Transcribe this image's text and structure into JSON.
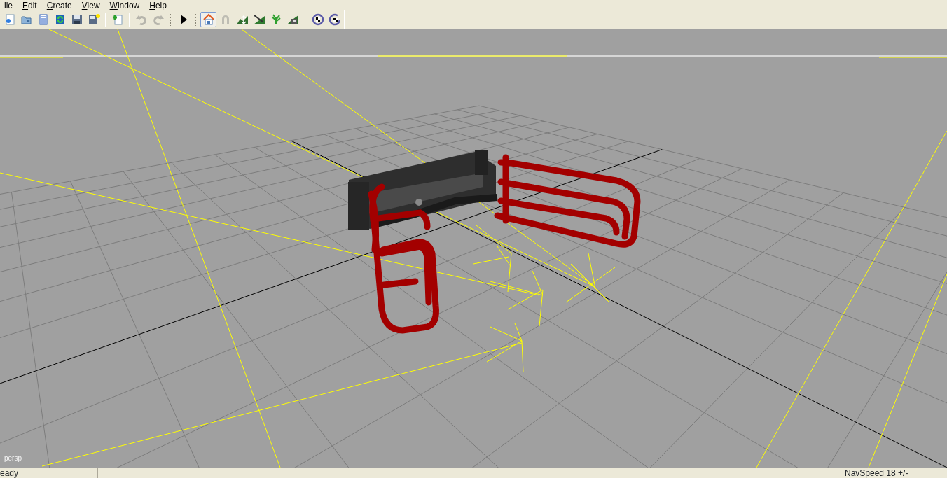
{
  "menu": [
    {
      "label": "ile",
      "underline_first": false
    },
    {
      "label": "Edit",
      "underline_first": true
    },
    {
      "label": "Create",
      "underline_first": true
    },
    {
      "label": "View",
      "underline_first": true
    },
    {
      "label": "Window",
      "underline_first": true
    },
    {
      "label": "Help",
      "underline_first": true
    }
  ],
  "toolbar": [
    {
      "grip": false,
      "buttons": [
        {
          "kind": "new",
          "disabled": false,
          "selected": false
        },
        {
          "kind": "open",
          "disabled": false,
          "selected": false
        },
        {
          "kind": "list",
          "disabled": false,
          "selected": false
        },
        {
          "kind": "refresh",
          "disabled": false,
          "selected": false
        },
        {
          "kind": "save",
          "disabled": false,
          "selected": false
        },
        {
          "kind": "saveas",
          "disabled": false,
          "selected": false
        }
      ]
    },
    {
      "grip": false,
      "buttons": [
        {
          "kind": "addpage",
          "disabled": false,
          "selected": false
        }
      ]
    },
    {
      "grip": false,
      "buttons": [
        {
          "kind": "undo",
          "disabled": true,
          "selected": false
        },
        {
          "kind": "redo",
          "disabled": true,
          "selected": false
        }
      ]
    },
    {
      "grip": true,
      "buttons": [
        {
          "kind": "play",
          "disabled": false,
          "selected": false
        }
      ]
    },
    {
      "grip": true,
      "buttons": [
        {
          "kind": "home",
          "disabled": false,
          "selected": true
        },
        {
          "kind": "magnet",
          "disabled": true,
          "selected": false
        },
        {
          "kind": "raise",
          "disabled": false,
          "selected": false
        },
        {
          "kind": "slope",
          "disabled": false,
          "selected": false
        },
        {
          "kind": "plant",
          "disabled": false,
          "selected": false
        },
        {
          "kind": "tsave",
          "disabled": false,
          "selected": false
        }
      ]
    },
    {
      "grip": true,
      "buttons": [
        {
          "kind": "rotchecker",
          "disabled": false,
          "selected": false
        },
        {
          "kind": "rotchecker2",
          "disabled": false,
          "selected": false
        }
      ]
    }
  ],
  "viewport": {
    "label": "persp"
  },
  "status_bar": {
    "message": "eady",
    "nav_speed": "NavSpeed 18 +/-"
  }
}
